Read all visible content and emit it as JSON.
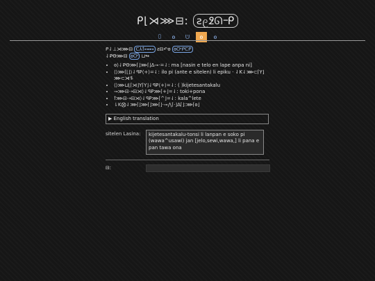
{
  "header": {
    "title_prefix": "ᑭ⌊⋊⋙⊟ː",
    "title_pill": "ꙅ᧙߶ᘏ᠆ᑭ",
    "nav": [
      "ꄲ",
      "ꙩ",
      "ᕫ",
      "ꙩ",
      "ꙩ"
    ]
  },
  "intro": {
    "line1": "ᑭ⇃⊥⋊⋙⊟",
    "pill1": "ᑕ⅄ꝉ⊶⊷",
    "line1b": "ꙅ⊟↶ꙩ",
    "pill2": "ꙩᏅᑭᑕᑭ",
    "line2": "⇃ꝐꝊ⋙⊟",
    "pill3": "ꙩᏅ",
    "line2b": "⊔↬"
  },
  "bullets": [
    {
      "glyphs": "ꙩ⟩⇃ꝐꝊ⋙⌈⌋⋙⌈⌋ᐃ⊸·=⇃ː",
      "desc": "ma [nasin e telo en lape anpa ni]"
    },
    {
      "glyphs": "⟨⟩⋙⌈⌊⌋⟩⇃ꟼꝐ⟨+⟩=⇃ː",
      "desc": "ilo pi (ante e sitelen) li epiku · ⇃K⇃⋙⊂⌈Y⌋⋙⊂⋊⥮"
    },
    {
      "glyphs": "⟨⟩⋙⊔⌊⌈⋊⌋Y⌈Y⌋⇃ꟼꝐ⟨+⟩=⇃ː",
      "desc": "( )kijetesantakalu"
    },
    {
      "glyphs": "⊸⋙⊟⇢⊟⋊⟩⇃ꟼꝐ⋙⌈+⌋=⇃ː",
      "desc": "toki+pona"
    },
    {
      "glyphs": "ꝉ⋙⊟⇢⊟⋊⟩⇃ꟼꝐ⋙⌈^⌋=⇃ː",
      "desc": "kala^lete"
    },
    {
      "glyphs": "⇂K⨂⇃⋙⌈⌋⋙⌈⌋⋙⌈⌋·⊸⋀⌈·⌋ᐃ⌈⌋ː⋙⌈ꙩ⌋",
      "desc": ""
    }
  ],
  "details": {
    "arrow": "▶",
    "label": "English translation"
  },
  "form": {
    "label": "sitelen Lasina:",
    "value": "kijetesantakalu-tonsi li lanpan e soko pi (wawa^usawi) jan [jelo,sewi,wawa,] li pana e pan tawa ona"
  },
  "output": {
    "label": "⊟ː",
    "value": ""
  }
}
